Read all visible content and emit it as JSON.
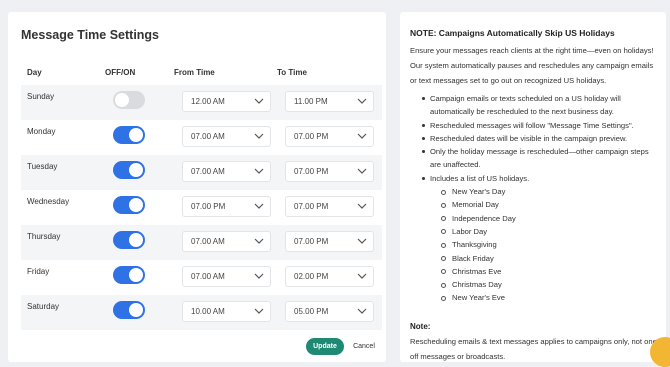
{
  "settings": {
    "title": "Message Time Settings",
    "headers": {
      "day": "Day",
      "onoff": "OFF/ON",
      "from": "From Time",
      "to": "To Time"
    },
    "rows": [
      {
        "day": "Sunday",
        "enabled": false,
        "from": "12.00 AM",
        "to": "11.00 PM"
      },
      {
        "day": "Monday",
        "enabled": true,
        "from": "07.00 AM",
        "to": "07.00 PM"
      },
      {
        "day": "Tuesday",
        "enabled": true,
        "from": "07.00 AM",
        "to": "07.00 PM"
      },
      {
        "day": "Wednesday",
        "enabled": true,
        "from": "07.00 PM",
        "to": "07.00 PM"
      },
      {
        "day": "Thursday",
        "enabled": true,
        "from": "07.00 AM",
        "to": "07.00 PM"
      },
      {
        "day": "Friday",
        "enabled": true,
        "from": "07.00 AM",
        "to": "02.00 PM"
      },
      {
        "day": "Saturday",
        "enabled": true,
        "from": "10.00 AM",
        "to": "05.00 PM"
      }
    ],
    "update_label": "Update",
    "cancel_label": "Cancel",
    "colors": {
      "toggle_on": "#2f72e6",
      "toggle_off": "#d9dbdf",
      "update_button": "#1e8a74"
    }
  },
  "note": {
    "title": "NOTE: Campaigns Automatically Skip US Holidays",
    "intro": "Ensure your messages reach clients at the right time—even on holidays! Our system automatically pauses and reschedules any campaign emails or text messages set to go out on recognized US holidays.",
    "bullets": [
      "Campaign emails or texts scheduled on a US holiday will automatically be rescheduled to the next business day.",
      "Rescheduled messages will follow \"Message Time Settings\".",
      "Rescheduled dates will be visible in the campaign preview.",
      "Only the holiday message is rescheduled—other campaign steps are unaffected.",
      "Includes a list of US holidays."
    ],
    "holidays": [
      "New Year's Day",
      "Memorial Day",
      "Independence Day",
      "Labor Day",
      "Thanksgiving",
      "Black Friday",
      "Christmas Eve",
      "Christmas Day",
      "New Year's Eve"
    ],
    "note_label": "Note:",
    "note_text": "Rescheduling emails & text messages applies to campaigns only, not one-off messages or broadcasts."
  }
}
